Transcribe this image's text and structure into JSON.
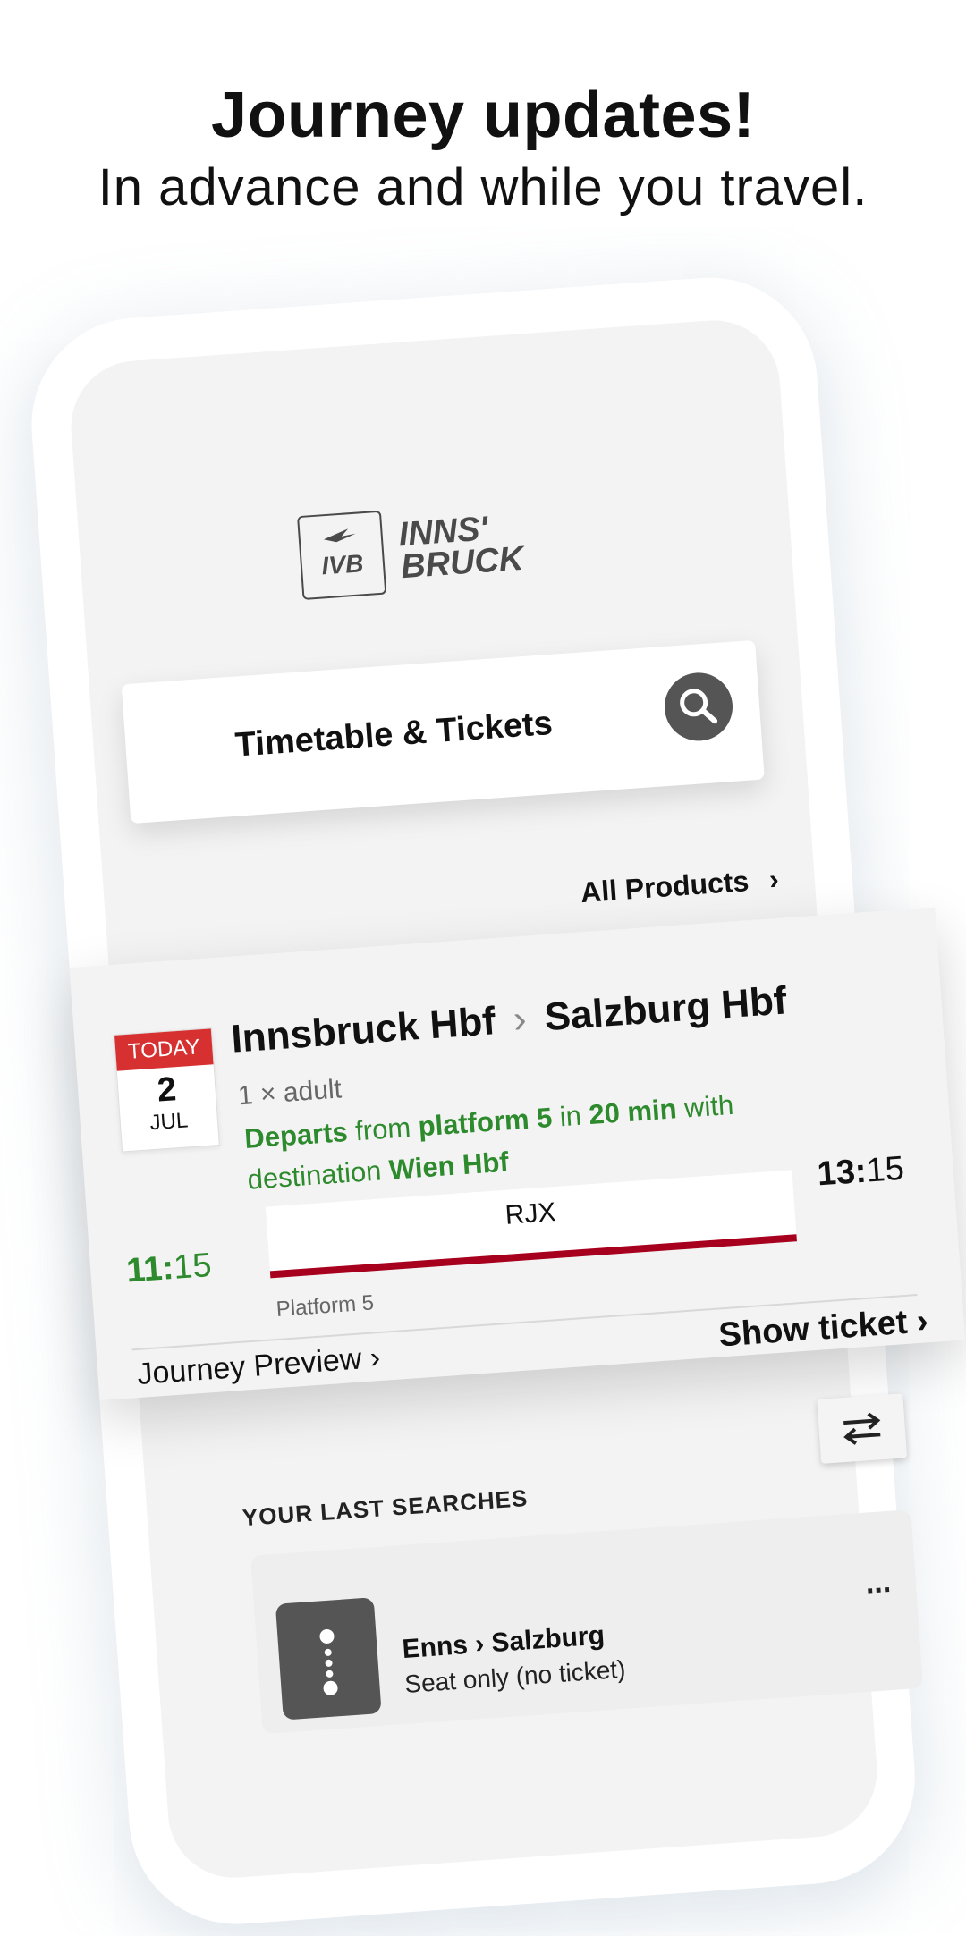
{
  "header": {
    "title": "Journey updates!",
    "subtitle": "In advance and while you travel."
  },
  "app": {
    "logo_badge": "IVB",
    "logo_line1": "INNS'",
    "logo_line2": "BRUCK",
    "search_label": "Timetable & Tickets",
    "all_products_label": "All Products"
  },
  "journey_card": {
    "date_tag": "TODAY",
    "date_day": "2",
    "date_month": "JUL",
    "from": "Innsbruck Hbf",
    "separator": "›",
    "to": "Salzburg Hbf",
    "passengers": "1 × adult",
    "status": {
      "w1": "Departs",
      "w2": "from",
      "w3": "platform 5",
      "w4": "in",
      "w5": "20 min",
      "w6": "with",
      "w7": "destination",
      "w8": "Wien Hbf"
    },
    "departure_hour": "11:",
    "departure_min": "15",
    "arrival_hour": "13:",
    "arrival_min": "15",
    "train": "RJX",
    "platform": "Platform 5",
    "journey_preview_label": "Journey Preview ›",
    "show_ticket_label": "Show ticket ›",
    "colors": {
      "green": "#2d8a2d",
      "train_line": "#a6001e",
      "today_red": "#d63031"
    }
  },
  "last_searches": {
    "title": "YOUR LAST SEARCHES",
    "items": [
      {
        "route": "Enns › Salzburg",
        "subtitle": "Seat only (no ticket)",
        "more": "..."
      }
    ]
  }
}
